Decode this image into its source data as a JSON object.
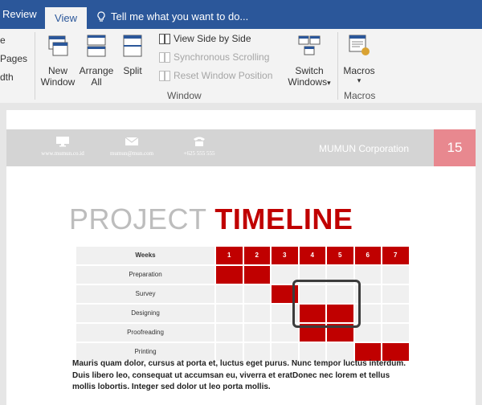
{
  "tabs": {
    "review": "Review",
    "view": "View",
    "tell_me": "Tell me what you want to do..."
  },
  "ribbon": {
    "partial_left": [
      "e",
      "Pages",
      "dth"
    ],
    "new_window": [
      "New",
      "Window"
    ],
    "arrange_all": [
      "Arrange",
      "All"
    ],
    "split": "Split",
    "view_side_by_side": "View Side by Side",
    "synchronous_scrolling": "Synchronous Scrolling",
    "reset_window_position": "Reset Window Position",
    "switch_windows": [
      "Switch",
      "Windows"
    ],
    "switch_windows_arrow": "▾",
    "macros": "Macros",
    "macros_arrow": "▾",
    "group_window": "Window",
    "group_macros": "Macros"
  },
  "icons": [
    "lightbulb-icon",
    "new-window-icon",
    "arrange-all-icon",
    "split-icon",
    "view-side-by-side-icon",
    "synchronous-scrolling-icon",
    "reset-window-position-icon",
    "switch-windows-icon",
    "macros-icon",
    "monitor-icon",
    "envelope-icon",
    "phone-icon"
  ],
  "colors": {
    "tabbar": "#2b579a",
    "accent_red": "#c00000",
    "page_number_bg": "#e8888f",
    "header_bg": "#d4d4d4"
  },
  "document": {
    "header": {
      "website": "www.mumun.co.id",
      "email": "mumun@mun.com",
      "phone": "+625 555 555",
      "company": "MUMUN Corporation",
      "page_number": "15"
    },
    "title_gray": "PROJECT",
    "title_red": "TIMELINE",
    "timeline": {
      "header_label": "Weeks",
      "weeks": [
        "1",
        "2",
        "3",
        "4",
        "5",
        "6",
        "7"
      ],
      "rows": [
        {
          "label": "Preparation",
          "active_weeks": [
            1,
            2
          ]
        },
        {
          "label": "Survey",
          "active_weeks": [
            3
          ]
        },
        {
          "label": "Designing",
          "active_weeks": [
            4,
            5
          ]
        },
        {
          "label": "Proofreading",
          "active_weeks": [
            4,
            5
          ]
        },
        {
          "label": "Printing",
          "active_weeks": [
            6,
            7
          ]
        }
      ]
    },
    "paragraph": "Mauris quam dolor, cursus at porta et, luctus eget purus. Nunc tempor luctus interdum. Duis libero leo, consequat ut accumsan eu, viverra et eratDonec nec lorem et tellus mollis lobortis. Integer sed dolor ut leo porta mollis."
  }
}
